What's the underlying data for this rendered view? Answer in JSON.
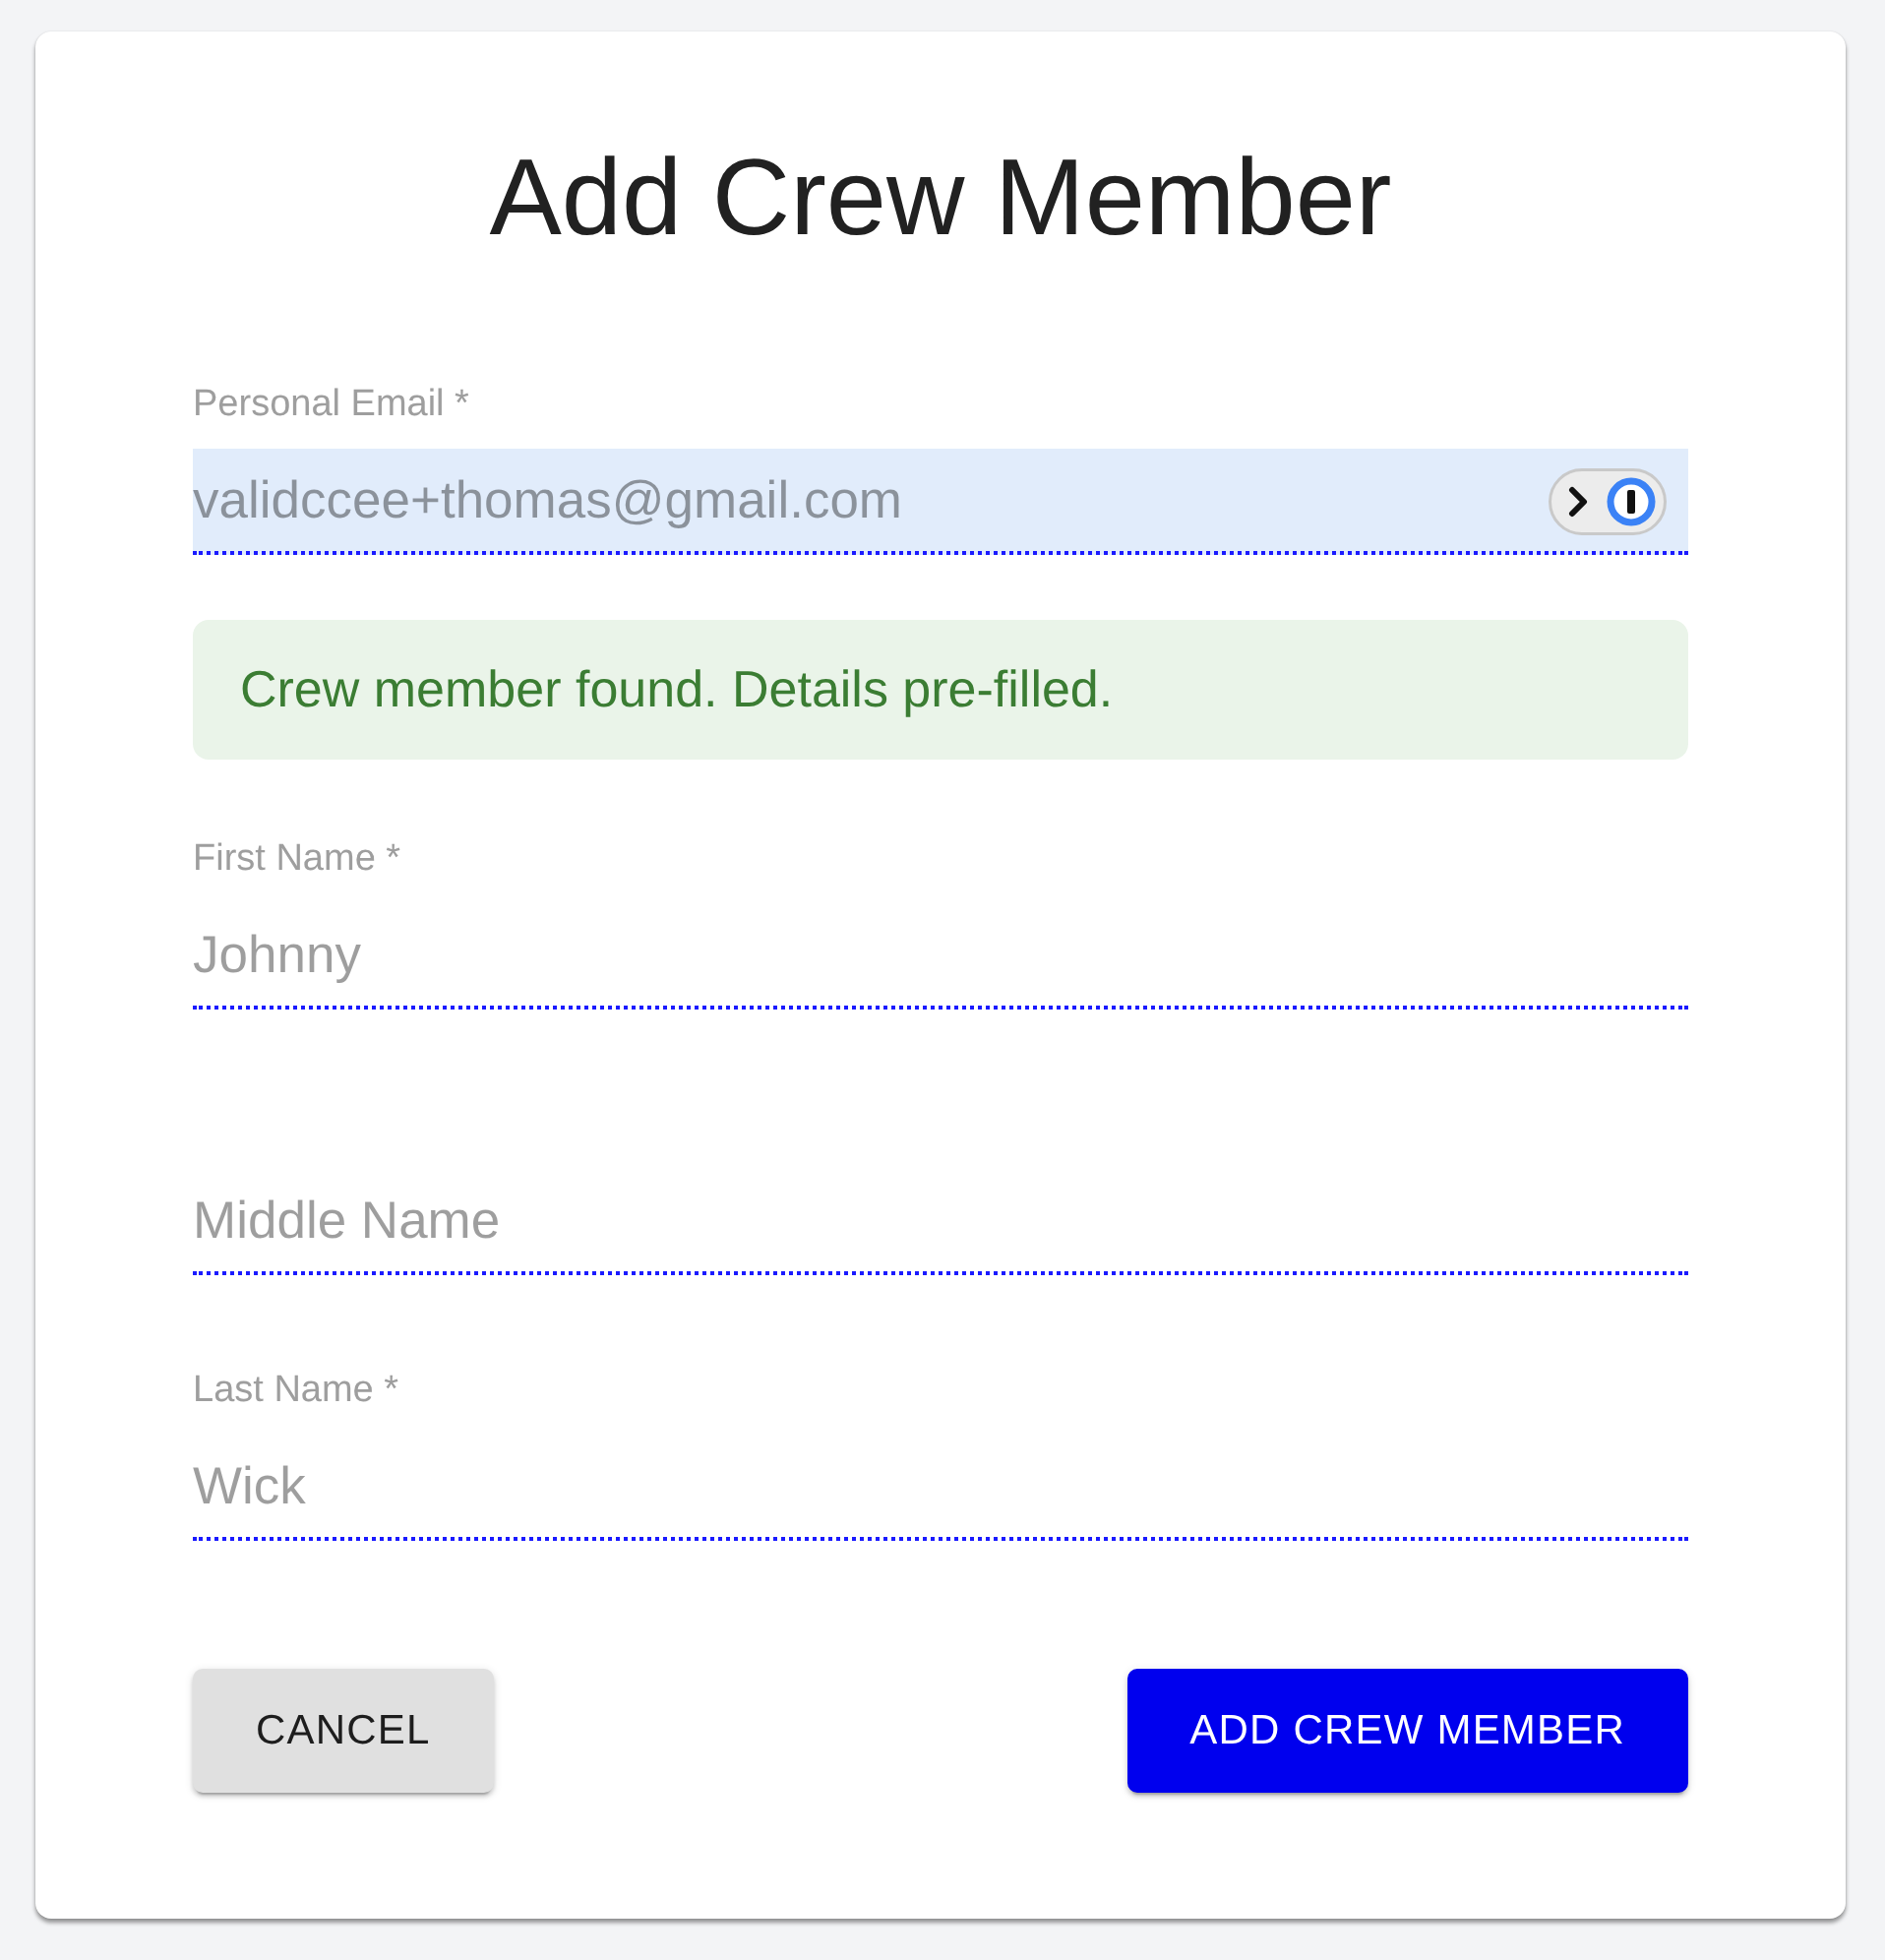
{
  "dialog": {
    "title": "Add Crew Member"
  },
  "email_field": {
    "label": "Personal Email *",
    "value": "validccee+thomas@gmail.com",
    "disabled": true,
    "autofilled": true
  },
  "alert": {
    "kind": "success",
    "text": "Crew member found. Details pre-filled."
  },
  "name_fields": [
    {
      "label": "First Name *",
      "value": "Johnny",
      "disabled": true,
      "autofilled": false
    },
    {
      "placeholder": "Middle Name",
      "disabled": true,
      "autofilled": false
    },
    {
      "label": "Last Name *",
      "value": "Wick",
      "disabled": true,
      "autofilled": false
    }
  ],
  "buttons": [
    {
      "label": "CANCEL",
      "kind": "secondary"
    },
    {
      "label": "ADD CREW MEMBER",
      "kind": "primary"
    }
  ]
}
